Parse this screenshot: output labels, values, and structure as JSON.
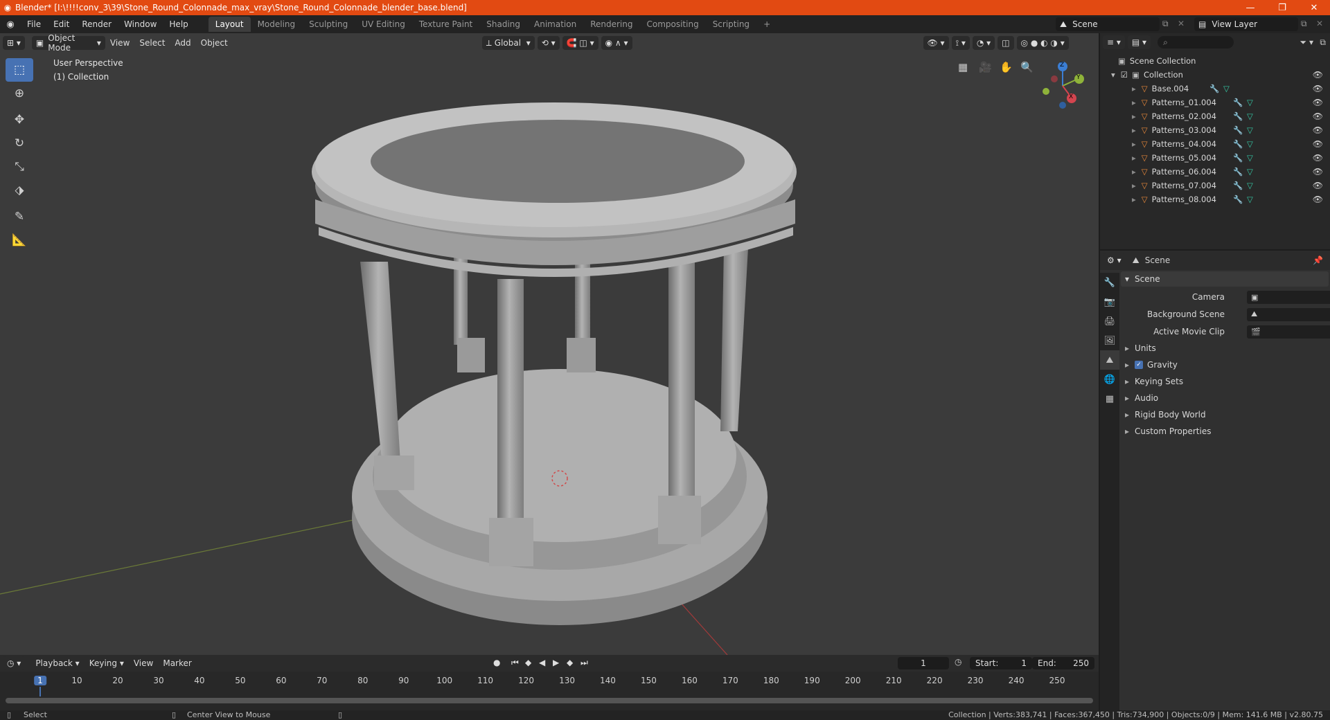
{
  "window": {
    "title": "Blender* [I:\\!!!!conv_3\\39\\Stone_Round_Colonnade_max_vray\\Stone_Round_Colonnade_blender_base.blend]",
    "minimize": "—",
    "maximize": "❐",
    "close": "✕"
  },
  "menubar": {
    "items": [
      "File",
      "Edit",
      "Render",
      "Window",
      "Help"
    ],
    "workspaces": [
      "Layout",
      "Modeling",
      "Sculpting",
      "UV Editing",
      "Texture Paint",
      "Shading",
      "Animation",
      "Rendering",
      "Compositing",
      "Scripting"
    ],
    "active_workspace": "Layout",
    "add_tab": "+",
    "scene": "Scene",
    "view_layer": "View Layer"
  },
  "viewport": {
    "mode": "Object Mode",
    "menus": [
      "View",
      "Select",
      "Add",
      "Object"
    ],
    "orientation": "Global",
    "perspective_label": "User Perspective",
    "collection_label": "(1) Collection",
    "gizmo_axes": [
      "X",
      "Y",
      "Z"
    ]
  },
  "outliner": {
    "search_placeholder": "",
    "root": "Scene Collection",
    "collection": "Collection",
    "objects": [
      "Base.004",
      "Patterns_01.004",
      "Patterns_02.004",
      "Patterns_03.004",
      "Patterns_04.004",
      "Patterns_05.004",
      "Patterns_06.004",
      "Patterns_07.004",
      "Patterns_08.004"
    ]
  },
  "properties": {
    "context": "Scene",
    "panel": "Scene",
    "camera_label": "Camera",
    "background_scene_label": "Background Scene",
    "active_clip_label": "Active Movie Clip",
    "sections": [
      "Units",
      "Gravity",
      "Keying Sets",
      "Audio",
      "Rigid Body World",
      "Custom Properties"
    ],
    "gravity_enabled": true
  },
  "timeline": {
    "menus": [
      "Playback",
      "Keying",
      "View",
      "Marker"
    ],
    "current_frame": "1",
    "start_label": "Start:",
    "start": "1",
    "end_label": "End:",
    "end": "250",
    "ruler": [
      "1",
      "10",
      "20",
      "30",
      "40",
      "50",
      "60",
      "70",
      "80",
      "90",
      "100",
      "110",
      "120",
      "130",
      "140",
      "150",
      "160",
      "170",
      "180",
      "190",
      "200",
      "210",
      "220",
      "230",
      "240",
      "250"
    ]
  },
  "statusbar": {
    "left_hint": "Select",
    "middle_hint": "Center View to Mouse",
    "stats": "Collection | Verts:383,741 | Faces:367,450 | Tris:734,900 | Objects:0/9 | Mem: 141.6 MB | v2.80.75"
  },
  "colors": {
    "title_bar": "#e24a12",
    "accent": "#4772b3",
    "object_icon": "#e8883a",
    "mesh_icon": "#35c7a5",
    "viewport_bg": "#3b3b3b"
  }
}
